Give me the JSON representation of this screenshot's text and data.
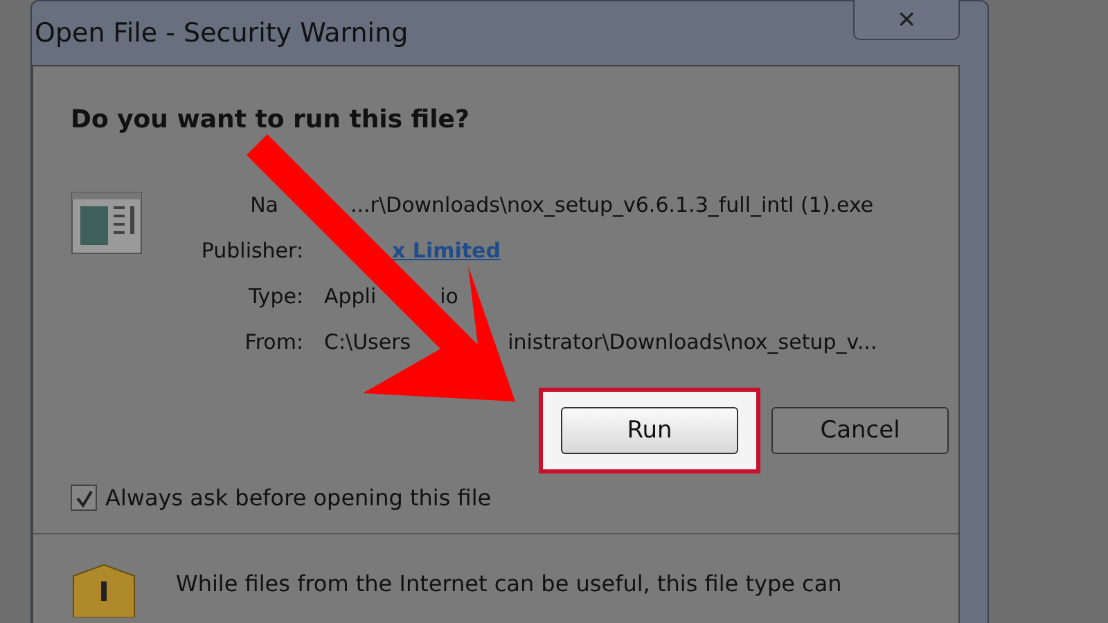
{
  "window": {
    "title": "Open File - Security Warning",
    "close": "✕"
  },
  "heading": "Do you want to run this file?",
  "details": [
    {
      "label": "Na",
      "parts": [
        "...r\\Downloads\\nox_setup_v6.6.1.3_full_intl (1).exe"
      ],
      "kind": "text"
    },
    {
      "label": "Publisher:",
      "parts": [
        "x Limited"
      ],
      "kind": "link"
    },
    {
      "label": "Type:",
      "parts": [
        "Appli",
        "io"
      ],
      "kind": "text"
    },
    {
      "label": "From:",
      "parts": [
        "C:\\Users",
        "inistrator\\Downloads\\nox_setup_v..."
      ],
      "kind": "text"
    }
  ],
  "buttons": [
    {
      "label": "Run",
      "highlighted": true
    },
    {
      "label": "Cancel",
      "highlighted": false
    }
  ],
  "checkbox": {
    "label": "Always ask before opening this file",
    "checked": true
  },
  "warning": "While files from the Internet can be useful, this file type can"
}
